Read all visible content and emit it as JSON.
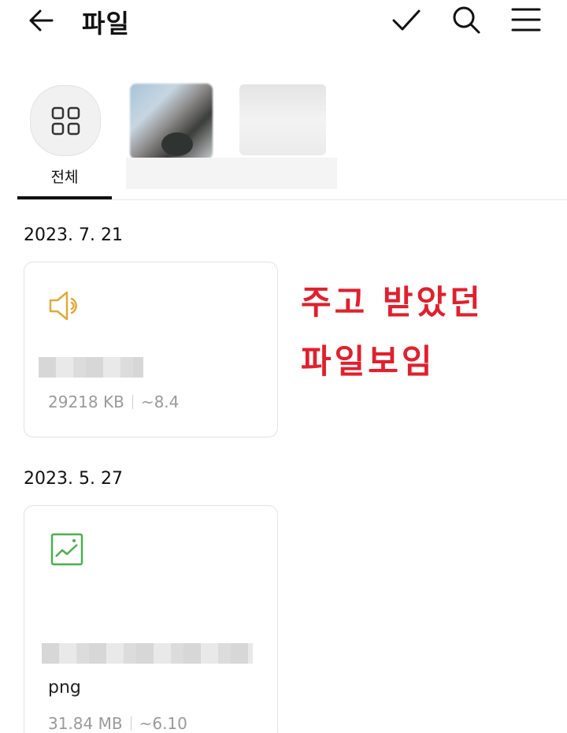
{
  "header": {
    "title": "파일",
    "back_icon": "arrow-left-icon",
    "check_icon": "check-icon",
    "search_icon": "search-icon",
    "menu_icon": "menu-icon"
  },
  "tabs": {
    "all_label": "전체",
    "all_icon": "grid-icon"
  },
  "annotation": {
    "line1": "주고 받았던",
    "line2": "파일보임",
    "color": "#e1202d"
  },
  "files": [
    {
      "date": "2023. 7. 21",
      "icon": "audio-icon",
      "icon_color": "#e2a93b",
      "size": "29218 KB",
      "expires": "~8.4"
    },
    {
      "date": "2023. 5. 27",
      "icon": "image-icon",
      "icon_color": "#4caf50",
      "ext": "png",
      "size": "31.84 MB",
      "expires": "~6.10"
    }
  ]
}
